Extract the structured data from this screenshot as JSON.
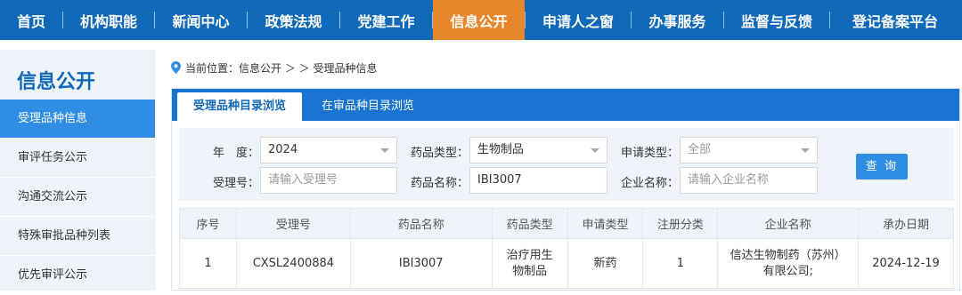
{
  "nav": {
    "items": [
      {
        "label": "首页"
      },
      {
        "label": "机构职能"
      },
      {
        "label": "新闻中心"
      },
      {
        "label": "政策法规"
      },
      {
        "label": "党建工作"
      },
      {
        "label": "信息公开"
      },
      {
        "label": "申请人之窗"
      },
      {
        "label": "办事服务"
      },
      {
        "label": "监督与反馈"
      },
      {
        "label": "登记备案平台"
      }
    ]
  },
  "sidebar": {
    "title": "信息公开",
    "items": [
      {
        "label": "受理品种信息"
      },
      {
        "label": "审评任务公示"
      },
      {
        "label": "沟通交流公示"
      },
      {
        "label": "特殊审批品种列表"
      },
      {
        "label": "优先审评公示"
      }
    ]
  },
  "breadcrumb": {
    "prefix": "当前位置：",
    "trail": "信息公开 ＞ ＞ 受理品种信息"
  },
  "tabs": [
    {
      "label": "受理品种目录浏览"
    },
    {
      "label": "在审品种目录浏览"
    }
  ],
  "filters": {
    "year_label": "年　度：",
    "year_value": "2024",
    "drug_type_label": "药品类型：",
    "drug_type_value": "生物制品",
    "apply_type_label": "申请类型：",
    "apply_type_value": "全部",
    "accept_no_label": "受理号：",
    "accept_no_placeholder": "请输入受理号",
    "drug_name_label": "药品名称：",
    "drug_name_value": "IBI3007",
    "company_label": "企业名称：",
    "company_placeholder": "请输入企业名称",
    "query_label": "查 询"
  },
  "table": {
    "headers": [
      "序号",
      "受理号",
      "药品名称",
      "药品类型",
      "申请类型",
      "注册分类",
      "企业名称",
      "承办日期"
    ],
    "rows": [
      {
        "index": "1",
        "accept_no": "CXSL2400884",
        "drug_name": "IBI3007",
        "drug_type_1": "治疗用生",
        "drug_type_2": "物制品",
        "apply_type": "新药",
        "reg_class": "1",
        "company_1": "信达生物制药（苏州）",
        "company_2": "有限公司;",
        "date": "2024-12-19"
      }
    ]
  },
  "colors": {
    "nav_bg": "#1068b8",
    "nav_active": "#e8872b",
    "accent": "#2f8de4"
  },
  "icons": {
    "breadcrumb": "location-pin-icon",
    "dropdown": "caret-down-icon"
  }
}
